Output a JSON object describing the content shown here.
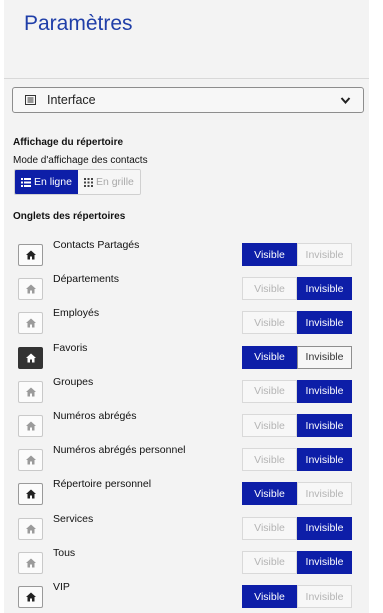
{
  "header": {
    "title": "Paramètres"
  },
  "section_select": {
    "value": "Interface"
  },
  "directory_display": {
    "title": "Affichage du répertoire",
    "mode_label": "Mode d'affichage des contacts",
    "modes": [
      {
        "label": "En ligne",
        "selected": true
      },
      {
        "label": "En grille",
        "selected": false
      }
    ]
  },
  "tabs_section": {
    "title": "Onglets des répertoires",
    "visible_label": "Visible",
    "invisible_label": "Invisible",
    "items": [
      {
        "label": "Contacts Partagés",
        "visible": true
      },
      {
        "label": "Départements",
        "visible": false
      },
      {
        "label": "Employés",
        "visible": false
      },
      {
        "label": "Favoris",
        "visible": true,
        "home": true
      },
      {
        "label": "Groupes",
        "visible": false
      },
      {
        "label": "Numéros abrégés",
        "visible": false
      },
      {
        "label": "Numéros abrégés personnel",
        "visible": false
      },
      {
        "label": "Répertoire personnel",
        "visible": true
      },
      {
        "label": "Services",
        "visible": false
      },
      {
        "label": "Tous",
        "visible": false
      },
      {
        "label": "VIP",
        "visible": true
      }
    ]
  },
  "colors": {
    "accent": "#0d1ea8",
    "title": "#1f3ea8",
    "panel_bg": "#f3f3f3"
  }
}
